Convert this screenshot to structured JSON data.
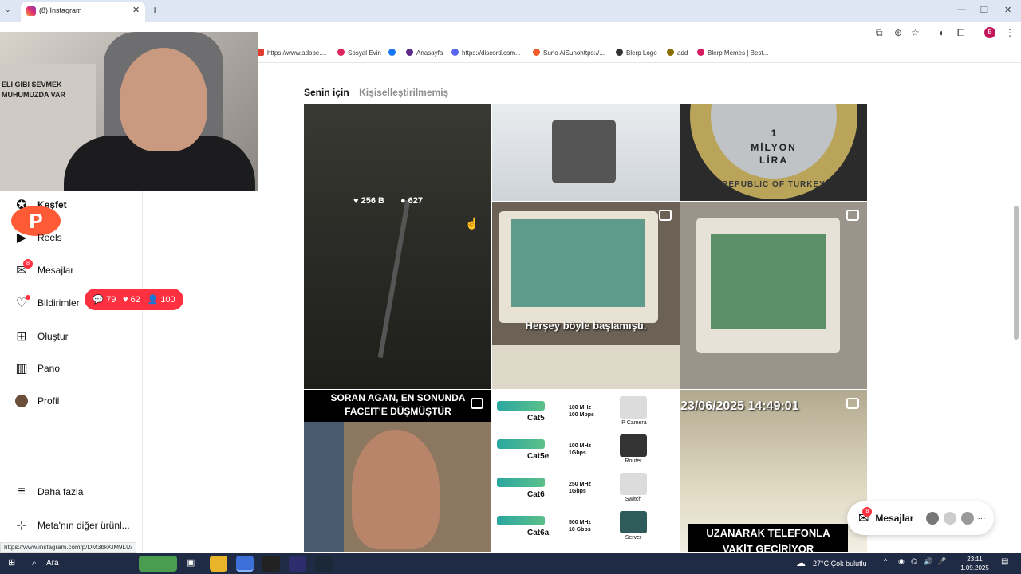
{
  "browser": {
    "tab_title": "(8) Instagram",
    "tab_close": "✕",
    "new_tab": "+",
    "window_controls": [
      "—",
      "❐",
      "✕"
    ],
    "status_url": "https://www.instagram.com/p/DM3bkKIM9LU/",
    "profile_initial": "B"
  },
  "bookmarks": [
    {
      "label": "https://www.adobe....",
      "color": "#e03d2f"
    },
    {
      "label": "Sosyal Evin",
      "color": "#e0245e"
    },
    {
      "label": "",
      "color": "#1877f2"
    },
    {
      "label": "Anasayfa",
      "color": "#5b2a86"
    },
    {
      "label": "https://discord.com...",
      "color": "#5865f2"
    },
    {
      "label": "Suno AiSunohttps://...",
      "color": "#f25c28"
    },
    {
      "label": "Blerp Logo",
      "color": "#333333"
    },
    {
      "label": "add",
      "color": "#8a6d00"
    },
    {
      "label": "Blerp Memes | Best...",
      "color": "#d81b60"
    }
  ],
  "webcam": {
    "poster_text": "ELİ GİBİ SEVMEK\nMUHUMUZDA VAR"
  },
  "sidebar": {
    "items": [
      {
        "label": "Keşfet",
        "icon": "compass-icon",
        "glyph": "✪"
      },
      {
        "label": "Reels",
        "icon": "reels-icon",
        "glyph": "▶"
      },
      {
        "label": "Mesajlar",
        "icon": "messenger-icon",
        "glyph": "✉",
        "badge": "8"
      },
      {
        "label": "Bildirimler",
        "icon": "heart-icon",
        "glyph": "♡"
      },
      {
        "label": "Oluştur",
        "icon": "plus-square-icon",
        "glyph": "⊞"
      },
      {
        "label": "Pano",
        "icon": "dashboard-icon",
        "glyph": "▥"
      },
      {
        "label": "Profil",
        "icon": "profile-avatar-icon",
        "glyph": "●"
      },
      {
        "label": "Daha fazla",
        "icon": "menu-icon",
        "glyph": "≡"
      },
      {
        "label": "Meta'nın diğer ürünl...",
        "icon": "meta-apps-icon",
        "glyph": "⊹"
      }
    ],
    "notification_pill": {
      "comments": "79",
      "likes": "62",
      "follows": "100"
    },
    "p_logo": "P"
  },
  "feed": {
    "tabs": [
      {
        "label": "Senin için",
        "active": true
      },
      {
        "label": "Kişiselleştirilmemiş",
        "active": false
      }
    ],
    "hover_stats": {
      "likes": "256 B",
      "comments": "627"
    },
    "captions": {
      "pc_video": "Herşey böyle başlamıştı.",
      "soran_agan": "SORAN AGAN, EN SONUNDA FACEIT'E DÜŞMÜŞTÜR",
      "timestamp": "23/06/2025 14:49:01",
      "phone": "UZANARAK TELEFONLA",
      "phone2": "VAKİT GEÇİRİYOR",
      "coin_top": "1",
      "coin_mid": "MİLYON",
      "coin_bottom": "LİRA",
      "coin_rim": "REPUBLIC OF TURKEY"
    },
    "network_rows": [
      {
        "name": "Cat5",
        "speed1": "100 MHz",
        "speed2": "100 Mpps",
        "device": "IP Camera"
      },
      {
        "name": "Cat5e",
        "speed1": "100 MHz",
        "speed2": "1Gbps",
        "device": "Router"
      },
      {
        "name": "Cat6",
        "speed1": "250 MHz",
        "speed2": "1Gbps",
        "device": "Switch"
      },
      {
        "name": "Cat6a",
        "speed1": "500 MHz",
        "speed2": "10 Gbps",
        "device": "Server"
      }
    ]
  },
  "floating_messages": {
    "label": "Mesajlar",
    "badge": "8",
    "more": "···"
  },
  "taskbar": {
    "search": "Ara",
    "weather": "27°C  Çok bulutlu",
    "time": "23:11",
    "date": "1.09.2025"
  }
}
